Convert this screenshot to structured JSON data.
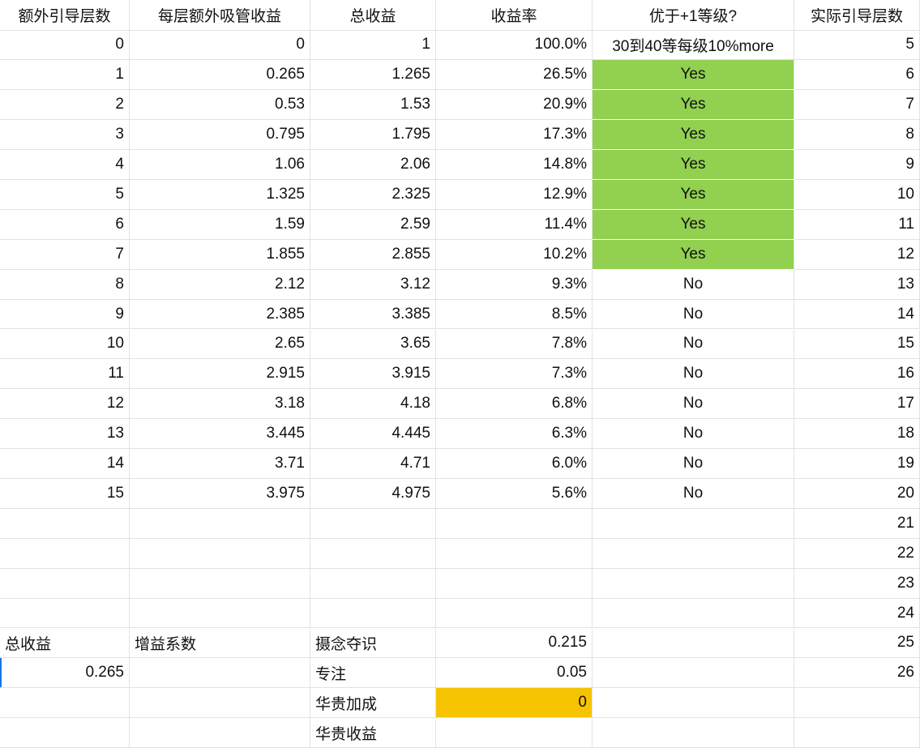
{
  "sheet": {
    "headers": [
      "额外引导层数",
      "每层额外吸管收益",
      "总收益",
      "收益率",
      "优于+1等级?",
      "实际引导层数"
    ],
    "rows": [
      [
        "0",
        "0",
        "1",
        "100.0%",
        "30到40等每级10%more",
        "5"
      ],
      [
        "1",
        "0.265",
        "1.265",
        "26.5%",
        "Yes",
        "6"
      ],
      [
        "2",
        "0.53",
        "1.53",
        "20.9%",
        "Yes",
        "7"
      ],
      [
        "3",
        "0.795",
        "1.795",
        "17.3%",
        "Yes",
        "8"
      ],
      [
        "4",
        "1.06",
        "2.06",
        "14.8%",
        "Yes",
        "9"
      ],
      [
        "5",
        "1.325",
        "2.325",
        "12.9%",
        "Yes",
        "10"
      ],
      [
        "6",
        "1.59",
        "2.59",
        "11.4%",
        "Yes",
        "11"
      ],
      [
        "7",
        "1.855",
        "2.855",
        "10.2%",
        "Yes",
        "12"
      ],
      [
        "8",
        "2.12",
        "3.12",
        "9.3%",
        "No",
        "13"
      ],
      [
        "9",
        "2.385",
        "3.385",
        "8.5%",
        "No",
        "14"
      ],
      [
        "10",
        "2.65",
        "3.65",
        "7.8%",
        "No",
        "15"
      ],
      [
        "11",
        "2.915",
        "3.915",
        "7.3%",
        "No",
        "16"
      ],
      [
        "12",
        "3.18",
        "4.18",
        "6.8%",
        "No",
        "17"
      ],
      [
        "13",
        "3.445",
        "4.445",
        "6.3%",
        "No",
        "18"
      ],
      [
        "14",
        "3.71",
        "4.71",
        "6.0%",
        "No",
        "19"
      ],
      [
        "15",
        "3.975",
        "4.975",
        "5.6%",
        "No",
        "20"
      ],
      [
        "",
        "",
        "",
        "",
        "",
        "21"
      ],
      [
        "",
        "",
        "",
        "",
        "",
        "22"
      ],
      [
        "",
        "",
        "",
        "",
        "",
        "23"
      ],
      [
        "",
        "",
        "",
        "",
        "",
        "24"
      ],
      [
        "总收益",
        "增益系数",
        "摄念夺识",
        "0.215",
        "",
        "25"
      ],
      [
        "0.265",
        "",
        "专注",
        "0.05",
        "",
        "26"
      ],
      [
        "",
        "",
        "华贵加成",
        "0",
        "",
        ""
      ],
      [
        "",
        "",
        "华贵收益",
        "",
        "",
        ""
      ]
    ],
    "colors": {
      "yes_fill": "#92d050",
      "highlight_fill": "#f6c300",
      "gridline": "#e2e3e3",
      "selection": "#1a73e8"
    }
  }
}
